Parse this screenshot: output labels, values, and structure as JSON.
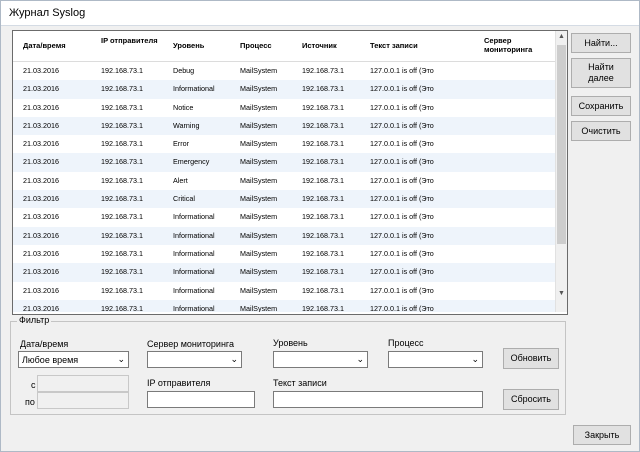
{
  "window": {
    "title": "Журнал Syslog"
  },
  "table": {
    "columns": [
      "Дата/время",
      "IP отправителя",
      "Уровень",
      "Процесс",
      "Источник",
      "Текст записи",
      "Сервер мониторинга"
    ],
    "rows": [
      [
        "21.03.2016",
        "192.168.73.1",
        "Debug",
        "MailSystem",
        "192.168.73.1",
        "127.0.0.1 is off (Это",
        ""
      ],
      [
        "21.03.2016",
        "192.168.73.1",
        "Informational",
        "MailSystem",
        "192.168.73.1",
        "127.0.0.1 is off (Это",
        ""
      ],
      [
        "21.03.2016",
        "192.168.73.1",
        "Notice",
        "MailSystem",
        "192.168.73.1",
        "127.0.0.1 is off (Это",
        ""
      ],
      [
        "21.03.2016",
        "192.168.73.1",
        "Warning",
        "MailSystem",
        "192.168.73.1",
        "127.0.0.1 is off (Это",
        ""
      ],
      [
        "21.03.2016",
        "192.168.73.1",
        "Error",
        "MailSystem",
        "192.168.73.1",
        "127.0.0.1 is off (Это",
        ""
      ],
      [
        "21.03.2016",
        "192.168.73.1",
        "Emergency",
        "MailSystem",
        "192.168.73.1",
        "127.0.0.1 is off (Это",
        ""
      ],
      [
        "21.03.2016",
        "192.168.73.1",
        "Alert",
        "MailSystem",
        "192.168.73.1",
        "127.0.0.1 is off (Это",
        ""
      ],
      [
        "21.03.2016",
        "192.168.73.1",
        "Critical",
        "MailSystem",
        "192.168.73.1",
        "127.0.0.1 is off (Это",
        ""
      ],
      [
        "21.03.2016",
        "192.168.73.1",
        "Informational",
        "MailSystem",
        "192.168.73.1",
        "127.0.0.1 is off (Это",
        ""
      ],
      [
        "21.03.2016",
        "192.168.73.1",
        "Informational",
        "MailSystem",
        "192.168.73.1",
        "127.0.0.1 is off (Это",
        ""
      ],
      [
        "21.03.2016",
        "192.168.73.1",
        "Informational",
        "MailSystem",
        "192.168.73.1",
        "127.0.0.1 is off (Это",
        ""
      ],
      [
        "21.03.2016",
        "192.168.73.1",
        "Informational",
        "MailSystem",
        "192.168.73.1",
        "127.0.0.1 is off (Это",
        ""
      ],
      [
        "21.03.2016",
        "192.168.73.1",
        "Informational",
        "MailSystem",
        "192.168.73.1",
        "127.0.0.1 is off (Это",
        ""
      ],
      [
        "21.03.2016",
        "192.168.73.1",
        "Informational",
        "MailSystem",
        "192.168.73.1",
        "127.0.0.1 is off (Это",
        ""
      ]
    ]
  },
  "buttons": {
    "find": "Найти...",
    "find_next": "Найти далее",
    "save": "Сохранить",
    "clear": "Очистить",
    "refresh": "Обновить",
    "reset": "Сбросить",
    "close": "Закрыть"
  },
  "filter": {
    "legend": "Фильтр",
    "datetime_label": "Дата/время",
    "datetime_value": "Любое время",
    "from_label": "с",
    "to_label": "по",
    "server_label": "Сервер мониторинга",
    "server_value": "",
    "level_label": "Уровень",
    "level_value": "",
    "process_label": "Процесс",
    "process_value": "",
    "sender_ip_label": "IP отправителя",
    "sender_ip_value": "",
    "record_text_label": "Текст записи",
    "record_text_value": ""
  }
}
